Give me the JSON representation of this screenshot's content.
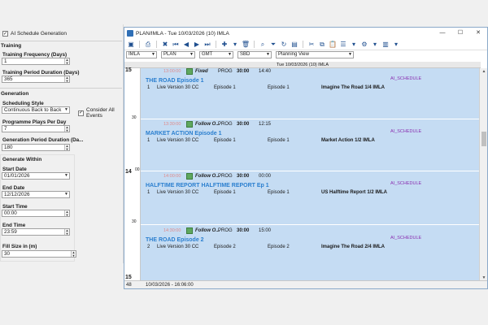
{
  "left_panel": {
    "ai_schedule_generation": "AI Schedule Generation",
    "training_section": "Training",
    "training_frequency_label": "Training Frequency (Days)",
    "training_frequency_value": "1",
    "training_period_label": "Training Period Duration (Days)",
    "training_period_value": "365",
    "generation_section": "Generation",
    "scheduling_style_label": "Scheduling Style",
    "scheduling_style_value": "Continuous Back to Back",
    "consider_all_events": "Consider All Events",
    "programme_plays_label": "Programme Plays Per Day",
    "programme_plays_value": "7",
    "generation_period_label": "Generation Period Duration (Da...",
    "generation_period_value": "180",
    "generate_within_label": "Generate Within",
    "start_date_label": "Start Date",
    "start_date_value": "01/01/2026",
    "end_date_label": "End Date",
    "end_date_value": "12/12/2026",
    "start_time_label": "Start Time",
    "start_time_value": "00:00",
    "end_time_label": "End Time",
    "end_time_value": "23:59",
    "fill_size_label": "Fill Size in (m)",
    "fill_size_value": "30"
  },
  "window": {
    "title": "PLAN/IMLA -  Tue 10/03/2026 (10) IMLA",
    "filters": {
      "channel": "IMLA",
      "plan": "PLAN",
      "timezone": "GMT",
      "sbd": "SBD",
      "view": "Planning View"
    },
    "column_header": "Tue 10/03/2026 (10) IMLA",
    "gutter": {
      "hour_top": "15",
      "min_30a": "30",
      "hour_mid": "14",
      "min_00": "00",
      "min_30b": "30",
      "hour_bottom": "15"
    },
    "status": {
      "count": "48",
      "timestamp": "10/03/2026 - 16:06:00"
    }
  },
  "events": [
    {
      "time": "13:00:00",
      "mode": "Fixed",
      "type": "PROG",
      "duration": "30:00",
      "start": "14:40",
      "title": "THE ROAD Episode 1",
      "tag": "AI_SCHEDULE",
      "row_num": "1",
      "version": "Live Version 30 CC",
      "col1": "Episode 1",
      "col2": "Episode 1",
      "description": "Imagine The Road 1/4 IMLA"
    },
    {
      "time": "13:30:00",
      "mode": "Follow O...",
      "type": "PROG",
      "duration": "30:00",
      "start": "12:15",
      "title": "MARKET ACTION Episode 1",
      "tag": "AI_SCHEDULE",
      "row_num": "1",
      "version": "Live Version 30 CC",
      "col1": "Episode 1",
      "col2": "Episode 1",
      "description": "Market Action 1/2 IMLA"
    },
    {
      "time": "14:00:00",
      "mode": "Follow O...",
      "type": "PROG",
      "duration": "30:00",
      "start": "00:00",
      "title": "HALFTIME REPORT HALFTIME REPORT Ep 1",
      "tag": "AI_SCHEDULE",
      "row_num": "1",
      "version": "Live Version 30 CC",
      "col1": "Episode 1",
      "col2": "Episode 1",
      "description": "US Halftime Report 1/2 IMLA"
    },
    {
      "time": "14:30:00",
      "mode": "Follow O...",
      "type": "PROG",
      "duration": "30:00",
      "start": "15:00",
      "title": "THE ROAD Episode 2",
      "tag": "AI_SCHEDULE",
      "row_num": "2",
      "version": "Live Version 30 CC",
      "col1": "Episode 2",
      "col2": "Episode 2",
      "description": "Imagine The Road 2/4 IMLA"
    }
  ]
}
